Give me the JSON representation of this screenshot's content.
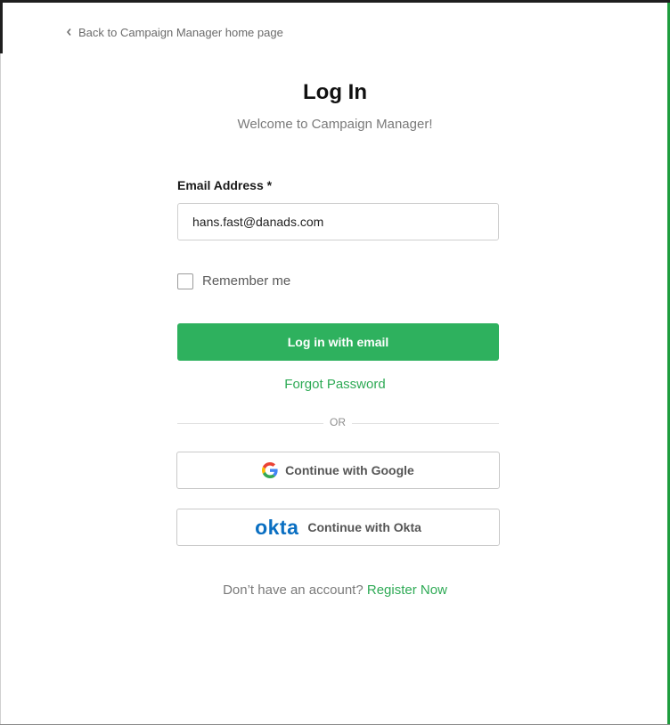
{
  "back_link": {
    "label": "Back to Campaign Manager home page",
    "icon": "chevron-left-icon"
  },
  "header": {
    "title": "Log In",
    "subtitle": "Welcome to Campaign Manager!"
  },
  "form": {
    "email_label": "Email Address *",
    "email_value": "hans.fast@danads.com",
    "remember_label": "Remember me",
    "remember_checked": false,
    "login_button": "Log in with email",
    "forgot_password": "Forgot Password"
  },
  "divider": {
    "label": "OR"
  },
  "social": {
    "google": {
      "label": "Continue with Google",
      "icon": "google-icon"
    },
    "okta": {
      "logo_text": "okta",
      "label": "Continue with Okta",
      "icon": "okta-logo"
    }
  },
  "footer": {
    "prompt": "Don’t have an account?",
    "register_link": "Register Now"
  },
  "colors": {
    "primary_green": "#2eb15e",
    "link_green": "#2eaa55",
    "okta_blue": "#0a6fc2",
    "text_dark": "#111111",
    "text_muted": "#7a7a7a"
  }
}
